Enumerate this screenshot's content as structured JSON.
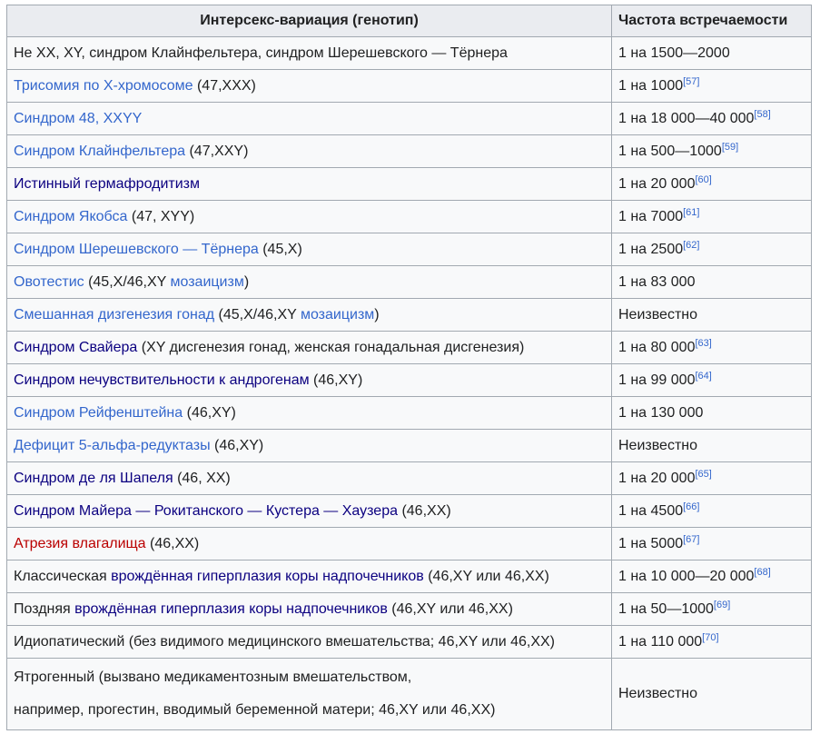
{
  "headers": [
    "Интерсекс-вариация (генотип)",
    "Частота встречаемости"
  ],
  "colors": {
    "link": "#3366cc",
    "visited": "#0b0080",
    "redlink": "#ba0000"
  },
  "rows": [
    {
      "variation": [
        {
          "t": "Не XX, XY, синдром Клайнфельтера, синдром Шерешевского — Тёрнера"
        }
      ],
      "freq": "1 на 1500—2000",
      "ref": ""
    },
    {
      "variation": [
        {
          "t": "Трисомия по X-хромосоме",
          "link": "new"
        },
        {
          "t": " (47,XXX)"
        }
      ],
      "freq": "1 на 1000",
      "ref": "[57]"
    },
    {
      "variation": [
        {
          "t": "Синдром 48, XXYY",
          "link": "new"
        }
      ],
      "freq": "1 на 18 000—40 000",
      "ref": "[58]"
    },
    {
      "variation": [
        {
          "t": "Синдром Клайнфельтера",
          "link": "new"
        },
        {
          "t": " (47,XXY)"
        }
      ],
      "freq": "1 на 500—1000",
      "ref": "[59]"
    },
    {
      "variation": [
        {
          "t": "Истинный гермафродитизм",
          "link": "visited"
        }
      ],
      "freq": "1 на 20 000",
      "ref": "[60]"
    },
    {
      "variation": [
        {
          "t": "Синдром Якобса",
          "link": "new"
        },
        {
          "t": " (47, XYY)"
        }
      ],
      "freq": "1 на 7000",
      "ref": "[61]"
    },
    {
      "variation": [
        {
          "t": "Синдром Шерешевского — Тёрнера",
          "link": "new"
        },
        {
          "t": " (45,X)"
        }
      ],
      "freq": "1 на 2500",
      "ref": "[62]"
    },
    {
      "variation": [
        {
          "t": "Овотестис",
          "link": "new"
        },
        {
          "t": " (45,X/46,XY "
        },
        {
          "t": "мозаицизм",
          "link": "new"
        },
        {
          "t": ")"
        }
      ],
      "freq": "1 на 83 000",
      "ref": ""
    },
    {
      "variation": [
        {
          "t": "Смешанная дизгенезия гонад",
          "link": "new"
        },
        {
          "t": " (45,X/46,XY "
        },
        {
          "t": "мозаицизм",
          "link": "new"
        },
        {
          "t": ")"
        }
      ],
      "freq": "Неизвестно",
      "ref": ""
    },
    {
      "variation": [
        {
          "t": "Синдром Свайера",
          "link": "visited"
        },
        {
          "t": " (XY дисгенезия гонад, женская гонадальная дисгенезия)"
        }
      ],
      "freq": "1 на 80 000",
      "ref": "[63]"
    },
    {
      "variation": [
        {
          "t": "Синдром нечувствительности к андрогенам",
          "link": "visited"
        },
        {
          "t": " (46,XY)"
        }
      ],
      "freq": "1 на 99 000",
      "ref": "[64]"
    },
    {
      "variation": [
        {
          "t": "Синдром Рейфенштейна",
          "link": "new"
        },
        {
          "t": " (46,XY)"
        }
      ],
      "freq": "1 на 130 000",
      "ref": ""
    },
    {
      "variation": [
        {
          "t": "Дефицит 5-альфа-редуктазы",
          "link": "new"
        },
        {
          "t": " (46,XY)"
        }
      ],
      "freq": "Неизвестно",
      "ref": ""
    },
    {
      "variation": [
        {
          "t": "Синдром де ля Шапеля",
          "link": "visited"
        },
        {
          "t": " (46, XX)"
        }
      ],
      "freq": "1 на 20 000",
      "ref": "[65]"
    },
    {
      "variation": [
        {
          "t": "Синдром Майера — Рокитанского — Кустера — Хаузера",
          "link": "visited"
        },
        {
          "t": " (46,XX)"
        }
      ],
      "freq": "1 на 4500",
      "ref": "[66]"
    },
    {
      "variation": [
        {
          "t": "Атрезия влагалища",
          "link": "red"
        },
        {
          "t": " (46,XX)"
        }
      ],
      "freq": "1 на 5000",
      "ref": "[67]"
    },
    {
      "variation": [
        {
          "t": "Классическая "
        },
        {
          "t": "врождённая гиперплазия коры надпочечников",
          "link": "visited"
        },
        {
          "t": " (46,XY или 46,XX)"
        }
      ],
      "freq": "1 на 10 000—20 000",
      "ref": "[68]"
    },
    {
      "variation": [
        {
          "t": "Поздняя "
        },
        {
          "t": "врождённая гиперплазия коры надпочечников",
          "link": "visited"
        },
        {
          "t": " (46,XY или 46,XX)"
        }
      ],
      "freq": "1 на 50—1000",
      "ref": "[69]"
    },
    {
      "variation": [
        {
          "t": "Идиопатический (без видимого медицинского вмешательства; 46,XY или 46,XX)"
        }
      ],
      "freq": "1 на 110 000",
      "ref": "[70]"
    }
  ],
  "last_row": {
    "lines": [
      "Ятрогенный (вызвано медикаментозным вмешательством,",
      "например, прогестин, вводимый беременной матери; 46,XY или 46,XX)"
    ],
    "freq": "Неизвестно"
  }
}
